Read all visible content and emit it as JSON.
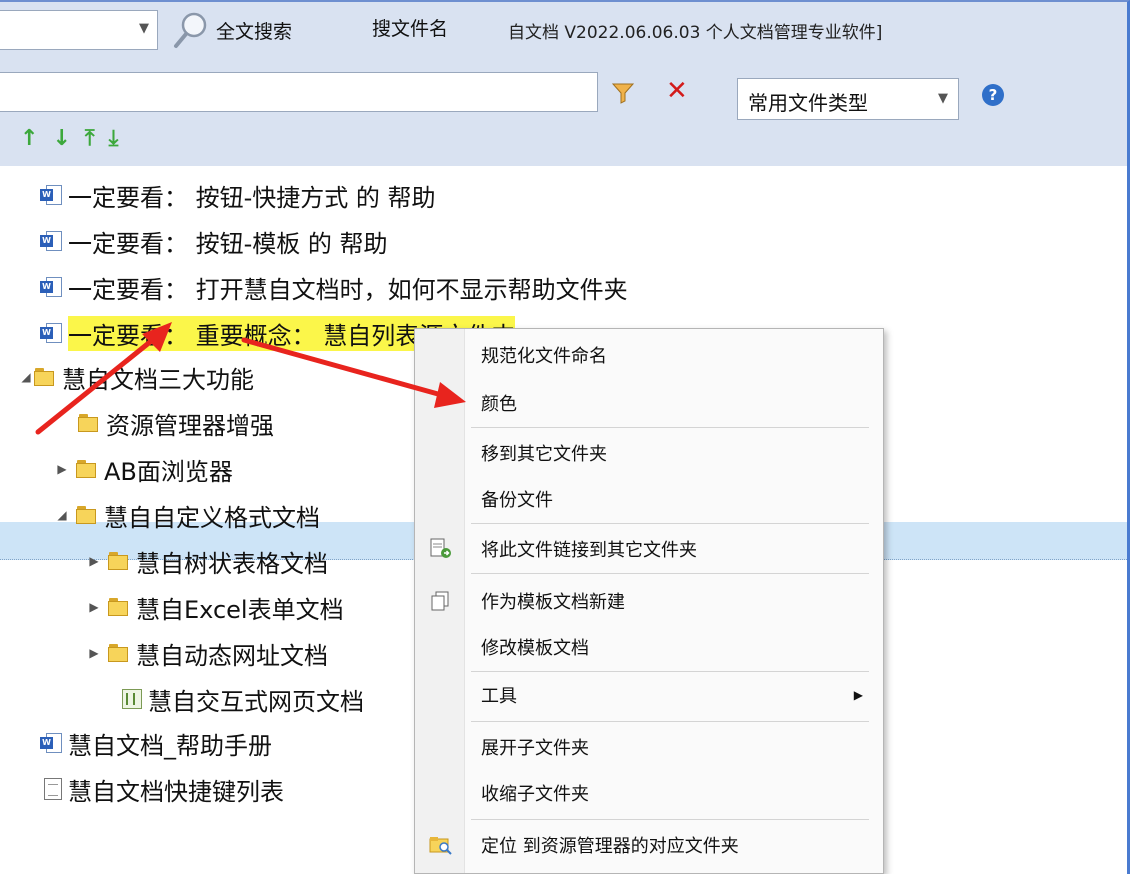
{
  "toolbar": {
    "fulltext_search_label": "全文搜索",
    "filename_search_label": "搜文件名",
    "app_title": "自文档 V2022.06.06.03 个人文档管理专业软件]",
    "file_type_select": "常用文件类型",
    "help_symbol": "?",
    "clear_symbol": "✕",
    "arrow_buttons": [
      "↑",
      "↓",
      "⤒",
      "⤓"
    ]
  },
  "tree": {
    "items": [
      {
        "label": "一定要看： 按钮-快捷方式 的 帮助",
        "icon": "word-doc-icon"
      },
      {
        "label": "一定要看： 按钮-模板 的 帮助",
        "icon": "word-doc-icon"
      },
      {
        "label": "一定要看： 打开慧自文档时，如何不显示帮助文件夹",
        "icon": "word-doc-icon"
      },
      {
        "label": "一定要看： 重要概念： 慧自列表源文件夹",
        "icon": "word-doc-icon"
      },
      {
        "label": "慧自文档三大功能",
        "icon": "folder-open-icon"
      },
      {
        "label": "资源管理器增强",
        "icon": "folder-icon"
      },
      {
        "label": "AB面浏览器",
        "icon": "folder-icon"
      },
      {
        "label": "慧自自定义格式文档",
        "icon": "folder-open-icon"
      },
      {
        "label": "慧自树状表格文档",
        "icon": "folder-icon"
      },
      {
        "label": "慧自Excel表单文档",
        "icon": "folder-icon"
      },
      {
        "label": "慧自动态网址文档",
        "icon": "folder-icon"
      },
      {
        "label": "慧自交互式网页文档",
        "icon": "web-doc-icon"
      },
      {
        "label": "慧自文档_帮助手册",
        "icon": "word-doc-icon"
      },
      {
        "label": "慧自文档快捷键列表",
        "icon": "text-doc-icon"
      }
    ]
  },
  "context_menu": {
    "items": [
      {
        "label": "规范化文件命名"
      },
      {
        "label": "颜色"
      },
      {
        "label": "移到其它文件夹"
      },
      {
        "label": "备份文件"
      },
      {
        "label": "将此文件链接到其它文件夹",
        "icon": "link-doc-icon"
      },
      {
        "label": "作为模板文档新建",
        "icon": "copy-icon"
      },
      {
        "label": "修改模板文档"
      },
      {
        "label": "工具",
        "submenu": true
      },
      {
        "label": "展开子文件夹"
      },
      {
        "label": "收缩子文件夹"
      },
      {
        "label": "定位 到资源管理器的对应文件夹",
        "icon": "locate-folder-icon"
      }
    ]
  },
  "colors": {
    "toolbar_bg": "#d9e2f1",
    "highlight_yellow": "#fbf64a",
    "selection_blue": "#cde4f7",
    "annotation_red": "#e8241e"
  }
}
